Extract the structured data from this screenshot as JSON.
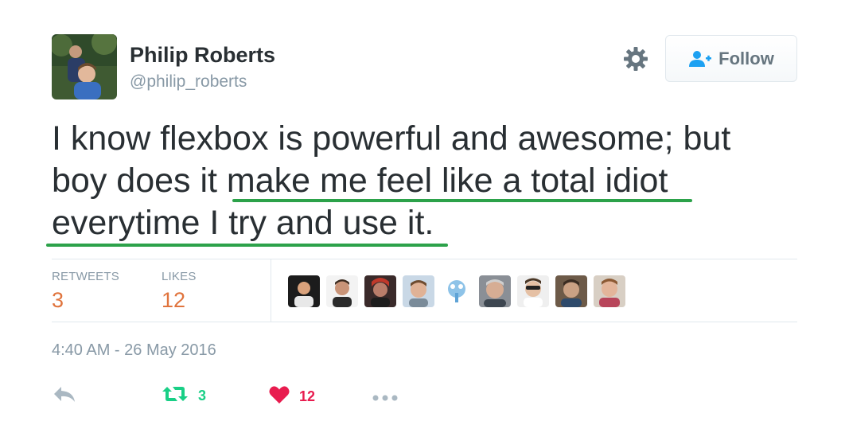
{
  "user": {
    "name": "Philip Roberts",
    "handle": "@philip_roberts"
  },
  "follow_label": "Follow",
  "tweet": {
    "line1": "I know flexbox is powerful and awesome; but",
    "line2_plain": "boy does it ",
    "line2_underlined": "make me feel like a total idiot",
    "line3": "everytime I try and use it."
  },
  "stats": {
    "retweets_label": "RETWEETS",
    "retweets_value": "3",
    "likes_label": "LIKES",
    "likes_value": "12"
  },
  "timestamp": "4:40 AM - 26 May 2016",
  "actions": {
    "retweet_count": "3",
    "like_count": "12"
  },
  "colors": {
    "underline": "#2ca24a",
    "stat_value": "#e0743d",
    "retweet": "#19cf86",
    "like": "#e81c4f",
    "muted": "#8899a6"
  },
  "icons": [
    "gear-icon",
    "follow-person-icon",
    "reply-icon",
    "retweet-icon",
    "heart-icon",
    "more-icon"
  ]
}
